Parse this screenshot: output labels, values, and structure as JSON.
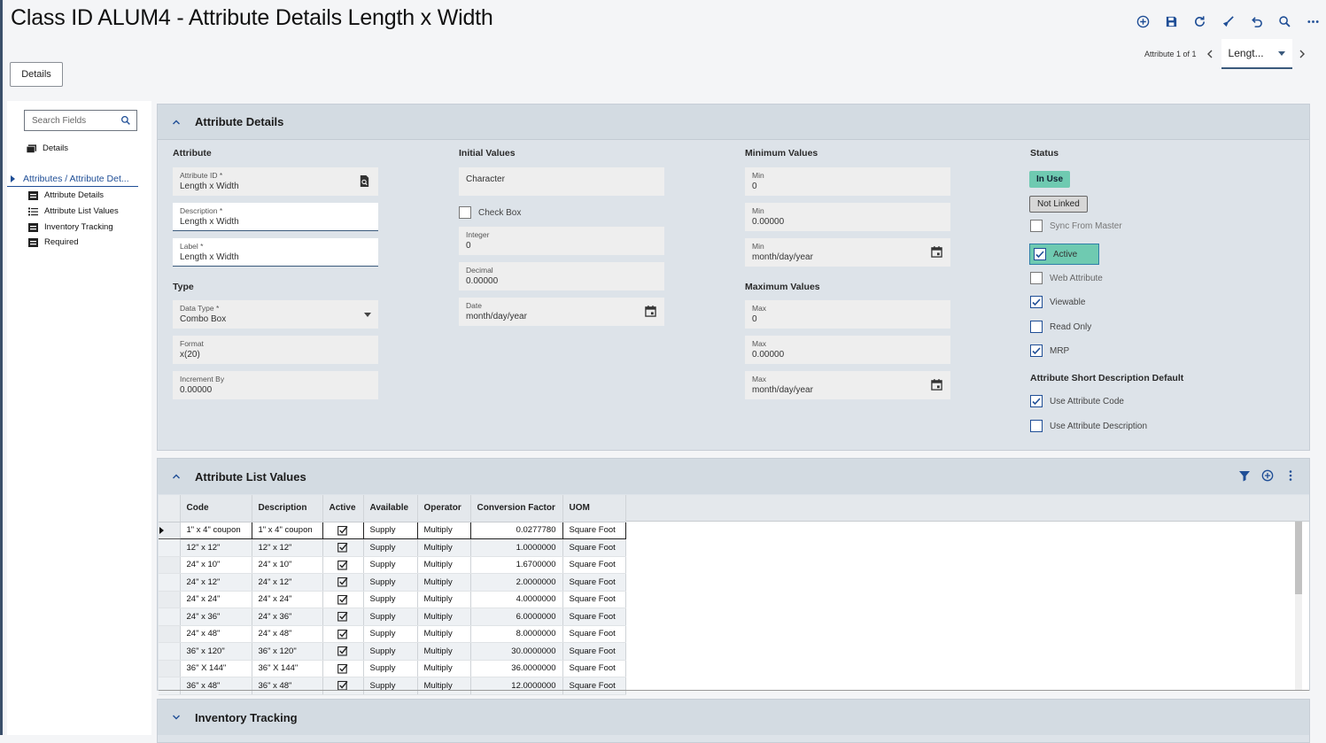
{
  "page": {
    "title": "Class ID ALUM4 - Attribute Details Length x Width"
  },
  "toolbar": {
    "icons": [
      "add-circle-icon",
      "save-icon",
      "refresh-icon",
      "clear-icon",
      "undo-icon",
      "search-icon",
      "more-icon"
    ]
  },
  "details_button": "Details",
  "record_nav": {
    "count_text": "Attribute 1 of 1",
    "selected": "Lengt..."
  },
  "sidebar": {
    "search_placeholder": "Search Fields",
    "details": "Details",
    "active_group": "Attributes / Attribute Det...",
    "items": [
      "Attribute Details",
      "Attribute List Values",
      "Inventory Tracking",
      "Required"
    ]
  },
  "attribute_details": {
    "title": "Attribute Details",
    "col_attribute": "Attribute",
    "attribute_id_label": "Attribute ID *",
    "attribute_id_value": "Length x Width",
    "description_label": "Description *",
    "description_value": "Length x Width",
    "label_label": "Label *",
    "label_value": "Length x Width",
    "type_title": "Type",
    "data_type_label": "Data Type *",
    "data_type_value": "Combo Box",
    "format_label": "Format",
    "format_value": "x(20)",
    "increment_label": "Increment By",
    "increment_value": "0.00000",
    "col_initial": "Initial Values",
    "character_label": "Character",
    "checkbox_label": "Check Box",
    "integer_label": "Integer",
    "integer_value": "0",
    "decimal_label": "Decimal",
    "decimal_value": "0.00000",
    "date_label": "Date",
    "date_value": "month/day/year",
    "col_minimum": "Minimum Values",
    "min_label": "Min",
    "min_int": "0",
    "min_dec": "0.00000",
    "min_date": "month/day/year",
    "col_maximum": "Maximum Values",
    "max_label": "Max",
    "max_int": "0",
    "max_dec": "0.00000",
    "max_date": "month/day/year",
    "col_status": "Status",
    "in_use": "In Use",
    "not_linked": "Not Linked",
    "sync_from_master": "Sync From Master",
    "active": "Active",
    "web_attribute": "Web Attribute",
    "viewable": "Viewable",
    "read_only": "Read Only",
    "mrp": "MRP",
    "short_desc_title": "Attribute Short Description Default",
    "use_attribute_code": "Use Attribute Code",
    "use_attribute_description": "Use Attribute Description"
  },
  "attribute_list_values": {
    "title": "Attribute List Values",
    "columns": [
      "Code",
      "Description",
      "Active",
      "Available",
      "Operator",
      "Conversion Factor",
      "UOM"
    ],
    "rows": [
      [
        "1\" x 4\" coupon",
        "1\" x 4\" coupon",
        "Supply",
        "Multiply",
        "0.0277780",
        "Square Foot"
      ],
      [
        "12\" x 12\"",
        "12\" x 12\"",
        "Supply",
        "Multiply",
        "1.0000000",
        "Square Foot"
      ],
      [
        "24\" x 10\"",
        "24\" x 10\"",
        "Supply",
        "Multiply",
        "1.6700000",
        "Square Foot"
      ],
      [
        "24\" x 12\"",
        "24\" x 12\"",
        "Supply",
        "Multiply",
        "2.0000000",
        "Square Foot"
      ],
      [
        "24\" x 24\"",
        "24\" x 24\"",
        "Supply",
        "Multiply",
        "4.0000000",
        "Square Foot"
      ],
      [
        "24\" x 36\"",
        "24\" x 36\"",
        "Supply",
        "Multiply",
        "6.0000000",
        "Square Foot"
      ],
      [
        "24\" x 48\"",
        "24\" x 48\"",
        "Supply",
        "Multiply",
        "8.0000000",
        "Square Foot"
      ],
      [
        "36\" x 120\"",
        "36\" x 120\"",
        "Supply",
        "Multiply",
        "30.0000000",
        "Square Foot"
      ],
      [
        "36\" X 144\"",
        "36\" X 144\"",
        "Supply",
        "Multiply",
        "36.0000000",
        "Square Foot"
      ],
      [
        "36\" x 48\"",
        "36\" x 48\"",
        "Supply",
        "Multiply",
        "12.0000000",
        "Square Foot"
      ]
    ]
  },
  "inventory_tracking": {
    "title": "Inventory Tracking"
  }
}
